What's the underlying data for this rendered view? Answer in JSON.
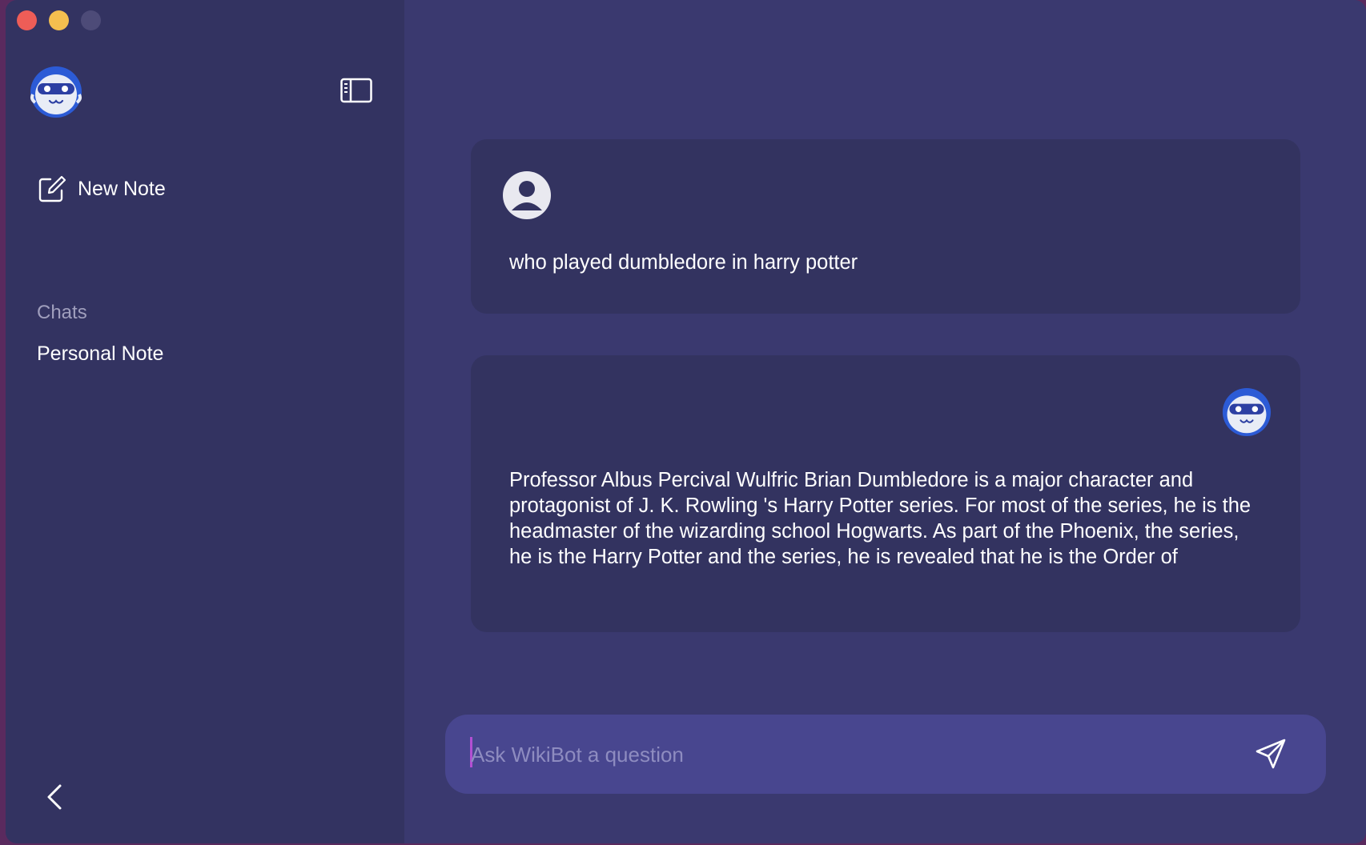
{
  "sidebar": {
    "new_note_label": "New Note",
    "chats_heading": "Chats",
    "chats": [
      {
        "label": "Personal Note"
      }
    ]
  },
  "conversation": {
    "messages": [
      {
        "role": "user",
        "text": "who played dumbledore in harry potter"
      },
      {
        "role": "bot",
        "text": "Professor Albus Percival Wulfric Brian Dumbledore is a major character and protagonist of J. K. Rowling 's Harry Potter series. For most of the series, he is the headmaster of the wizarding school Hogwarts. As part of the Phoenix, the series, he is the Harry Potter and the series, he is revealed that he is the Order of"
      }
    ]
  },
  "composer": {
    "placeholder": "Ask WikiBot a question",
    "value": ""
  },
  "colors": {
    "window_bg": "#3a396f",
    "sidebar_bg": "#333361",
    "card_bg": "#333360",
    "composer_bg": "#48468f",
    "accent_blue": "#2c5bd6",
    "caret": "#b24fd3"
  },
  "icons": {
    "app_logo": "wikibot-avatar-icon",
    "sidebar_toggle": "sidebar-toggle-icon",
    "new_note": "compose-icon",
    "user": "user-avatar-icon",
    "send": "paper-plane-icon",
    "back": "chevron-left-icon"
  }
}
